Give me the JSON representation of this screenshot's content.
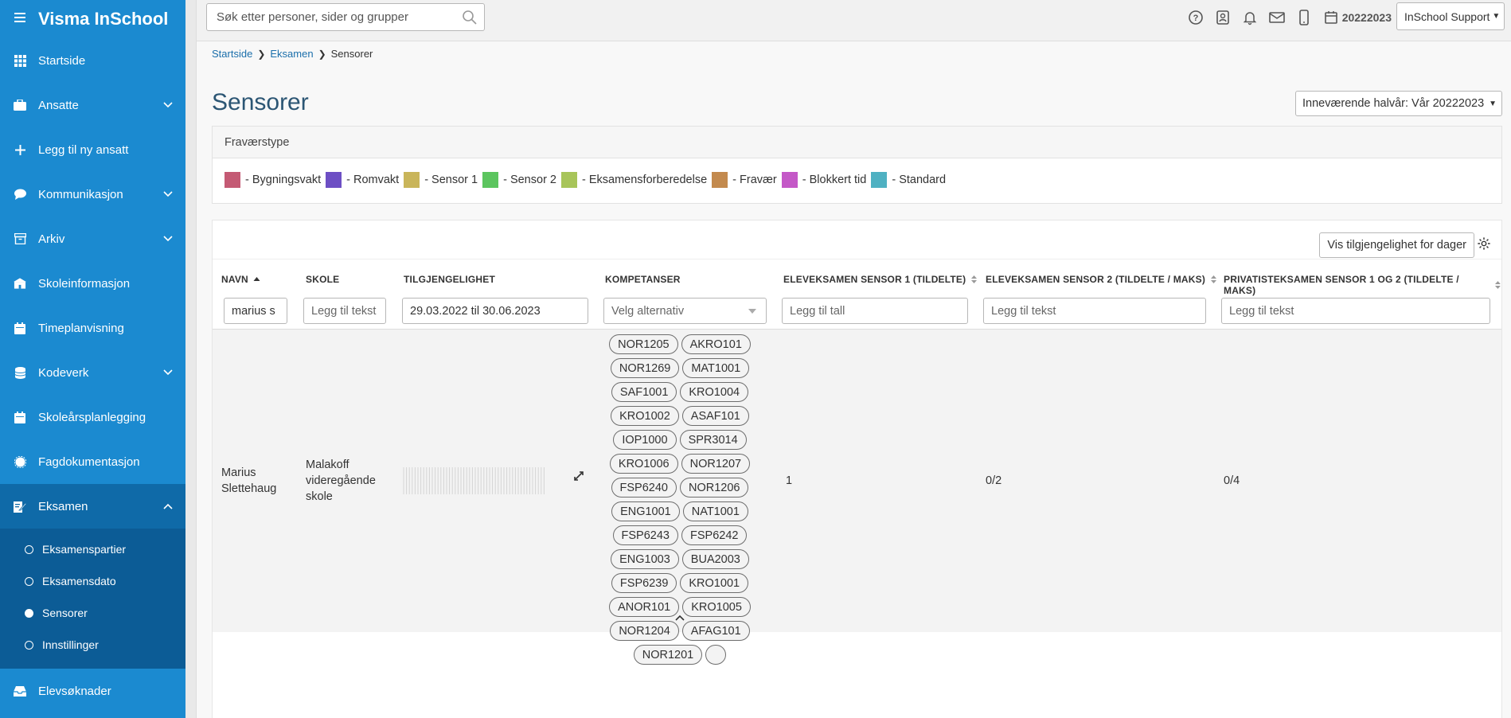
{
  "app": {
    "title": "Visma InSchool"
  },
  "sidebar": {
    "items": [
      {
        "label": "Startside",
        "icon": "grid-icon"
      },
      {
        "label": "Ansatte",
        "icon": "briefcase-icon"
      },
      {
        "label": "Legg til ny ansatt",
        "icon": "plus-icon"
      },
      {
        "label": "Kommunikasjon",
        "icon": "chat-icon"
      },
      {
        "label": "Arkiv",
        "icon": "archive-icon"
      },
      {
        "label": "Skoleinformasjon",
        "icon": "school-icon"
      },
      {
        "label": "Timeplanvisning",
        "icon": "calendar-icon"
      },
      {
        "label": "Kodeverk",
        "icon": "database-icon"
      },
      {
        "label": "Skoleårsplanlegging",
        "icon": "calendar-icon"
      },
      {
        "label": "Fagdokumentasjon",
        "icon": "badge-icon"
      },
      {
        "label": "Eksamen",
        "icon": "exam-icon"
      },
      {
        "label": "Elevsøknader",
        "icon": "inbox-icon"
      }
    ],
    "subitems": [
      {
        "label": "Eksamenspartier"
      },
      {
        "label": "Eksamensdato"
      },
      {
        "label": "Sensorer"
      },
      {
        "label": "Innstillinger"
      }
    ]
  },
  "topbar": {
    "search_placeholder": "Søk etter personer, sider og grupper",
    "year": "20222023",
    "user": "InSchool Support"
  },
  "breadcrumb": {
    "items": [
      "Startside",
      "Eksamen",
      "Sensorer"
    ]
  },
  "page": {
    "title": "Sensorer",
    "semester_select": "Inneværende halvår: Vår 20222023"
  },
  "legend": {
    "title": "Fraværstype",
    "items": [
      {
        "label": "- Bygningsvakt",
        "color": "#c45a74"
      },
      {
        "label": "- Romvakt",
        "color": "#6d4fc4"
      },
      {
        "label": "- Sensor 1",
        "color": "#c9b55a"
      },
      {
        "label": "- Sensor 2",
        "color": "#5cc55f"
      },
      {
        "label": "- Eksamensforberedelse",
        "color": "#a8c55a"
      },
      {
        "label": "- Fravær",
        "color": "#c38a4e"
      },
      {
        "label": "- Blokkert tid",
        "color": "#c458c7"
      },
      {
        "label": "- Standard",
        "color": "#4fb1c2"
      }
    ]
  },
  "table": {
    "show_availability_button": "Vis tilgjengelighet for dager",
    "columns": [
      "NAVN",
      "SKOLE",
      "TILGJENGELIGHET",
      "KOMPETANSER",
      "ELEVEKSAMEN SENSOR 1 (TILDELTE)",
      "ELEVEKSAMEN SENSOR 2 (TILDELTE / MAKS)",
      "PRIVATISTEKSAMEN SENSOR 1 OG 2 (TILDELTE / MAKS)"
    ],
    "filters": {
      "name_value": "marius s",
      "school_placeholder": "Legg til tekst",
      "availability_value": "29.03.2022 til 30.06.2023",
      "competence_placeholder": "Velg alternativ",
      "sensor1_placeholder": "Legg til tall",
      "sensor2_placeholder": "Legg til tekst",
      "private_placeholder": "Legg til tekst"
    },
    "rows": [
      {
        "name": "Marius Slettehaug",
        "school": "Malakoff videregående skole",
        "competences": [
          "NOR1205",
          "AKRO101",
          "NOR1269",
          "MAT1001",
          "SAF1001",
          "KRO1004",
          "KRO1002",
          "ASAF101",
          "IOP1000",
          "SPR3014",
          "KRO1006",
          "NOR1207",
          "FSP6240",
          "NOR1206",
          "ENG1001",
          "NAT1001",
          "FSP6243",
          "FSP6242",
          "ENG1003",
          "BUA2003",
          "FSP6239",
          "KRO1001",
          "ANOR101",
          "KRO1005",
          "NOR1204",
          "AFAG101",
          "NOR1201",
          ""
        ],
        "sensor1": "1",
        "sensor2": "0/2",
        "private": "0/4"
      }
    ]
  }
}
